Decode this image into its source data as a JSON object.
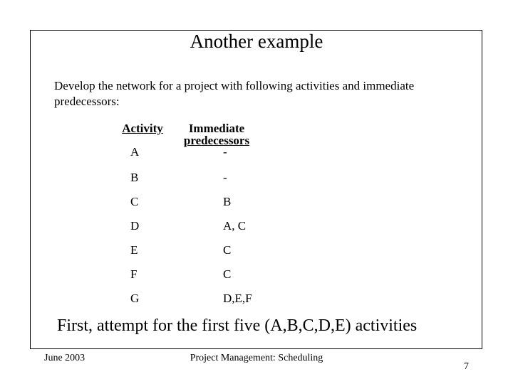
{
  "slide": {
    "title": "Another example",
    "intro": "Develop the network for a project with following activities and immediate predecessors:",
    "table": {
      "headers": {
        "activity": "Activity",
        "predecessors_line1": "Immediate",
        "predecessors_line2": "predecessors"
      },
      "rows": [
        {
          "activity": "A",
          "predecessors": "-"
        },
        {
          "activity": "B",
          "predecessors": "-"
        },
        {
          "activity": "C",
          "predecessors": "B"
        },
        {
          "activity": "D",
          "predecessors": "A, C"
        },
        {
          "activity": "E",
          "predecessors": "C"
        },
        {
          "activity": "F",
          "predecessors": "C"
        },
        {
          "activity": "G",
          "predecessors": "D,E,F"
        }
      ]
    },
    "closing": "First, attempt for the first five (A,B,C,D,E) activities"
  },
  "footer": {
    "date": "June 2003",
    "center": "Project Management: Scheduling",
    "page_number": "7"
  }
}
